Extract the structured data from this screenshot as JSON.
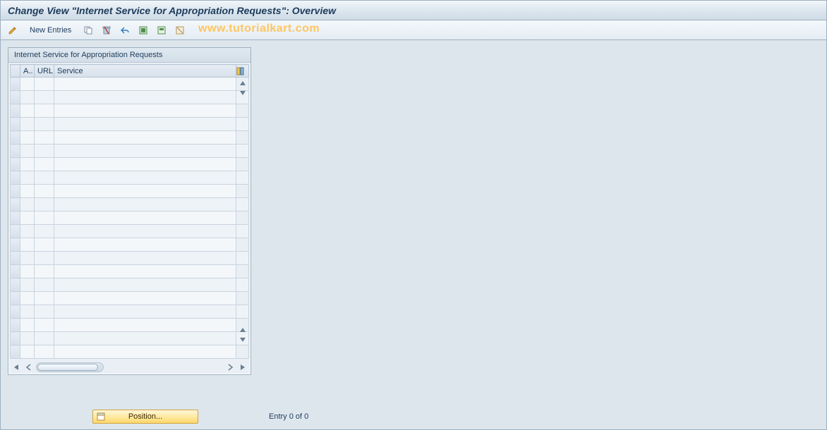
{
  "header": {
    "title": "Change View \"Internet Service for Appropriation Requests\": Overview"
  },
  "toolbar": {
    "new_entries_label": "New Entries"
  },
  "watermark": "www.tutorialkart.com",
  "panel": {
    "title": "Internet Service for Appropriation Requests",
    "columns": {
      "a": "A..",
      "url": "URL",
      "service": "Service"
    },
    "rows_count": 21
  },
  "footer": {
    "position_label": "Position...",
    "entry_text": "Entry 0 of 0"
  }
}
